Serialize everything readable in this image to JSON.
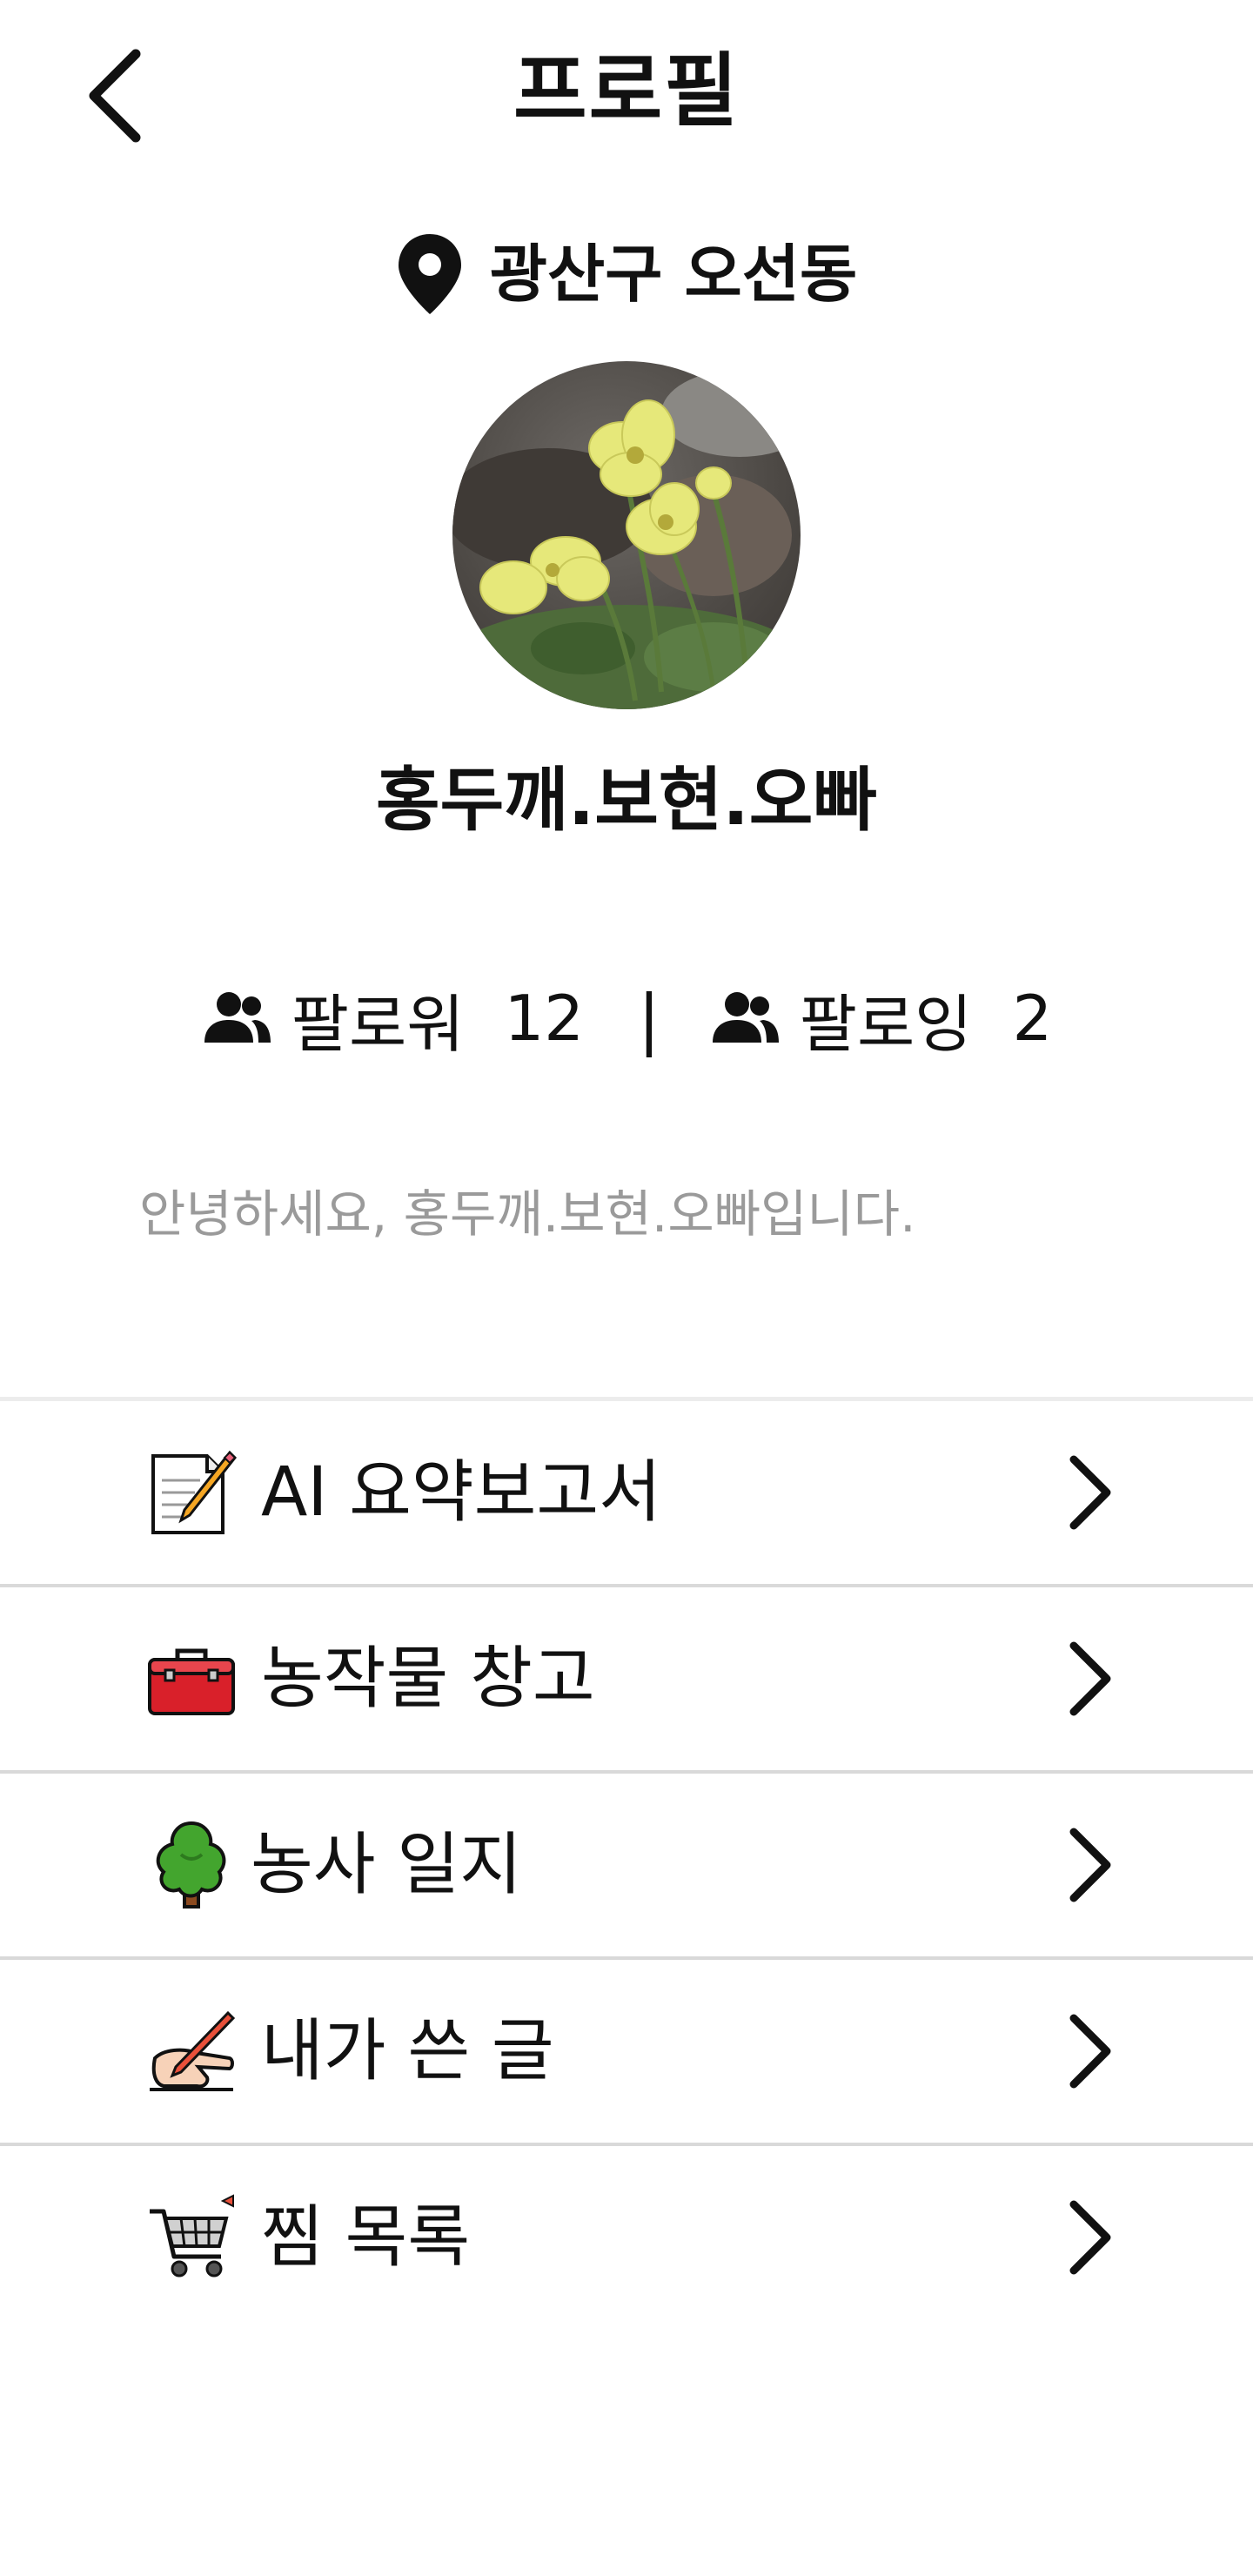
{
  "header": {
    "title": "프로필",
    "back_icon": "chevron-left-icon"
  },
  "location": {
    "icon": "map-pin-icon",
    "text": "광산구 오선동"
  },
  "profile": {
    "avatar_description_icon": "flower-photo",
    "username": "홍두깨.보현.오빠",
    "bio": "안녕하세요, 홍두깨.보현.오빠입니다."
  },
  "stats": {
    "followers_label": "팔로워",
    "followers_count": "12",
    "separator": "|",
    "following_label": "팔로잉",
    "following_count": "2",
    "icon": "users-icon"
  },
  "menu": {
    "items": [
      {
        "label": "AI 요약보고서",
        "icon": "memo-icon"
      },
      {
        "label": "농작물 창고",
        "icon": "toolbox-icon"
      },
      {
        "label": "농사 일지",
        "icon": "tree-icon"
      },
      {
        "label": "내가 쓴 글",
        "icon": "writing-hand-icon"
      },
      {
        "label": "찜 목록",
        "icon": "shopping-cart-icon"
      }
    ],
    "chevron_icon": "chevron-right-icon"
  },
  "colors": {
    "text": "#111111",
    "bio_text": "#9a9a9a",
    "divider": "#d9d9d9",
    "background": "#ffffff"
  }
}
